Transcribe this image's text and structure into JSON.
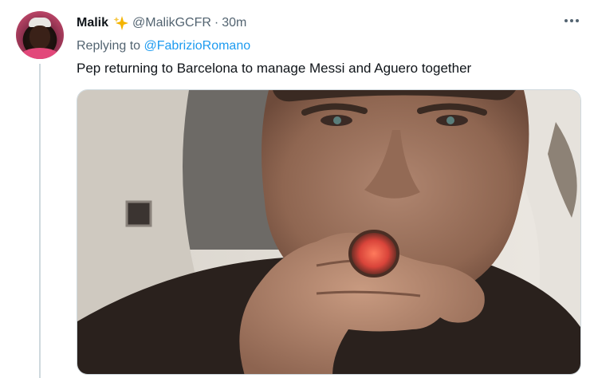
{
  "tweet": {
    "author_name": "Malik",
    "author_badge_icon": "sparkle-icon",
    "handle": "@MalikGCFR",
    "separator": "·",
    "time": "30m",
    "replying_to_prefix": "Replying to ",
    "replying_to_handle": "@FabrizioRomano",
    "text": "Pep returning to Barcelona to manage Messi and Aguero together",
    "more_icon": "more-options-icon"
  },
  "colors": {
    "link": "#1d9bf0",
    "secondary_text": "#536471",
    "primary_text": "#0f1419",
    "thread_line": "#cfd9de",
    "sparkle": "#f4b400"
  }
}
